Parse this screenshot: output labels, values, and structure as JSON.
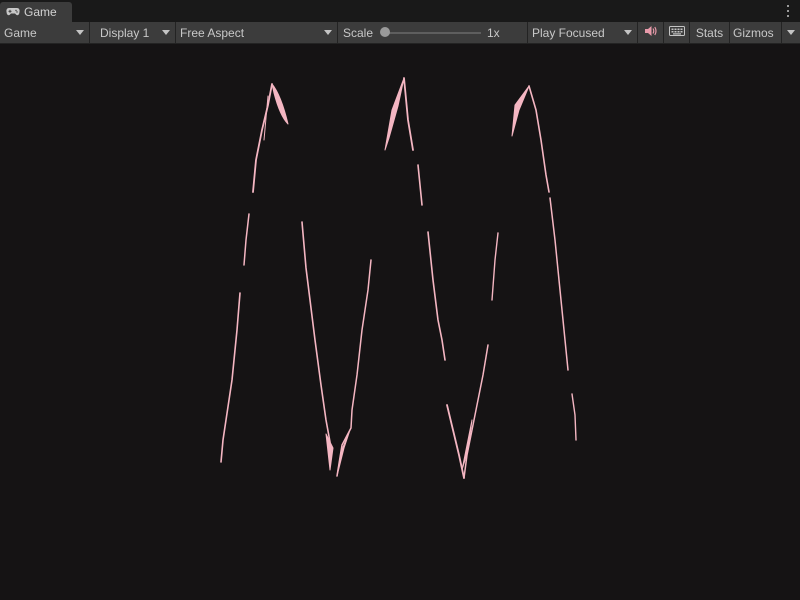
{
  "window": {
    "tab_label": "Game",
    "tab_icon": "gamepad-icon"
  },
  "toolbar": {
    "view_dropdown": "Game",
    "display_dropdown": "Display 1",
    "aspect_dropdown": "Free Aspect",
    "scale_label": "Scale",
    "scale_value": "1x",
    "scale_level": 0.0,
    "play_mode_dropdown": "Play Focused",
    "mute_icon": "speaker-icon",
    "keyboard_icon": "keyboard-icon",
    "stats_label": "Stats",
    "gizmos_label": "Gizmos"
  },
  "colors": {
    "viewport_bg": "#151314",
    "stroke": "#f4b6c2",
    "toolbar_bg": "#3c3c3c",
    "mute_icon_color": "#e89aaa"
  }
}
